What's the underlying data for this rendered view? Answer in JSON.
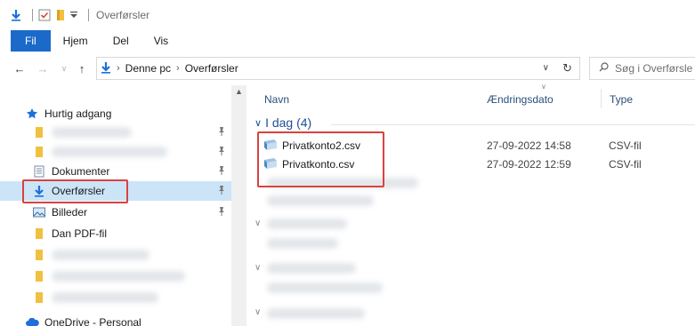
{
  "window": {
    "title": "Overførsler"
  },
  "ribbon": {
    "tabs": [
      "Fil",
      "Hjem",
      "Del",
      "Vis"
    ]
  },
  "address": {
    "crumbs": [
      "Denne pc",
      "Overførsler"
    ]
  },
  "search": {
    "placeholder": "Søg i Overførsle"
  },
  "nav": {
    "quick_access": "Hurtig adgang",
    "items": [
      {
        "label": "Dokumenter",
        "icon": "documents-icon",
        "pinned": true
      },
      {
        "label": "Overførsler",
        "icon": "downloads-icon",
        "pinned": true,
        "selected": true
      },
      {
        "label": "Billeder",
        "icon": "pictures-icon",
        "pinned": true
      },
      {
        "label": "Dan PDF-fil",
        "icon": "folder-icon",
        "pinned": false
      }
    ],
    "onedrive": "OneDrive - Personal"
  },
  "columns": {
    "name": "Navn",
    "date": "Ændringsdato",
    "type": "Type"
  },
  "group": {
    "label": "I dag (4)"
  },
  "files": [
    {
      "name": "Privatkonto2.csv",
      "date": "27-09-2022 14:58",
      "type": "CSV-fil"
    },
    {
      "name": "Privatkonto.csv",
      "date": "27-09-2022 12:59",
      "type": "CSV-fil"
    }
  ],
  "colors": {
    "accent": "#1b6ac9",
    "highlight": "#d9433e",
    "folder": "#f0c040",
    "selected_bg": "#cce4f7"
  }
}
